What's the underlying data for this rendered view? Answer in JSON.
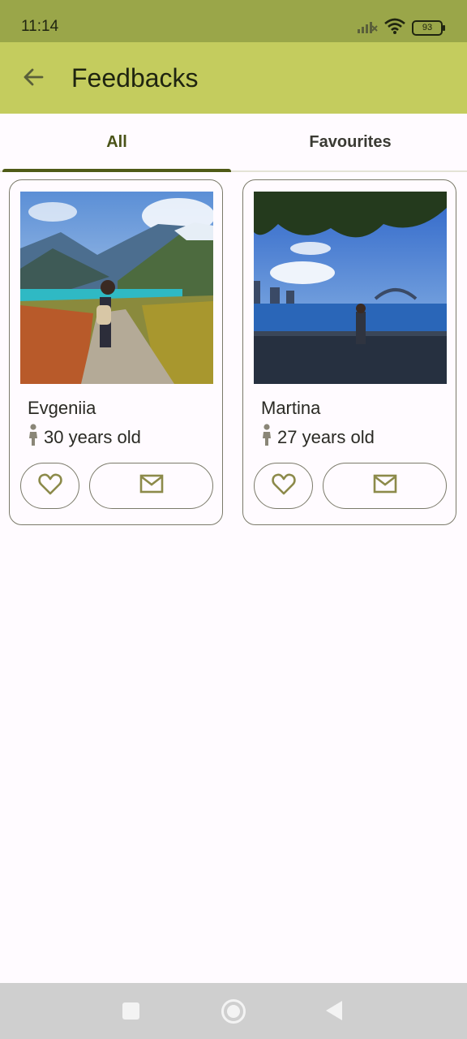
{
  "status_bar": {
    "time": "11:14",
    "battery": "93"
  },
  "app_bar": {
    "title": "Feedbacks"
  },
  "tabs": [
    {
      "label": "All",
      "selected": true
    },
    {
      "label": "Favourites",
      "selected": false
    }
  ],
  "cards": [
    {
      "name": "Evgeniia",
      "age": "30 years old"
    },
    {
      "name": "Martina",
      "age": "27 years old"
    }
  ],
  "colors": {
    "status_bar": "#9aa649",
    "app_bar": "#c4cc5e",
    "accent": "#4f5a17",
    "icon": "#8c8a4a"
  },
  "icons": [
    "back-arrow-icon",
    "wifi-icon",
    "signal-icon",
    "battery-icon",
    "person-icon",
    "heart-icon",
    "mail-icon"
  ]
}
